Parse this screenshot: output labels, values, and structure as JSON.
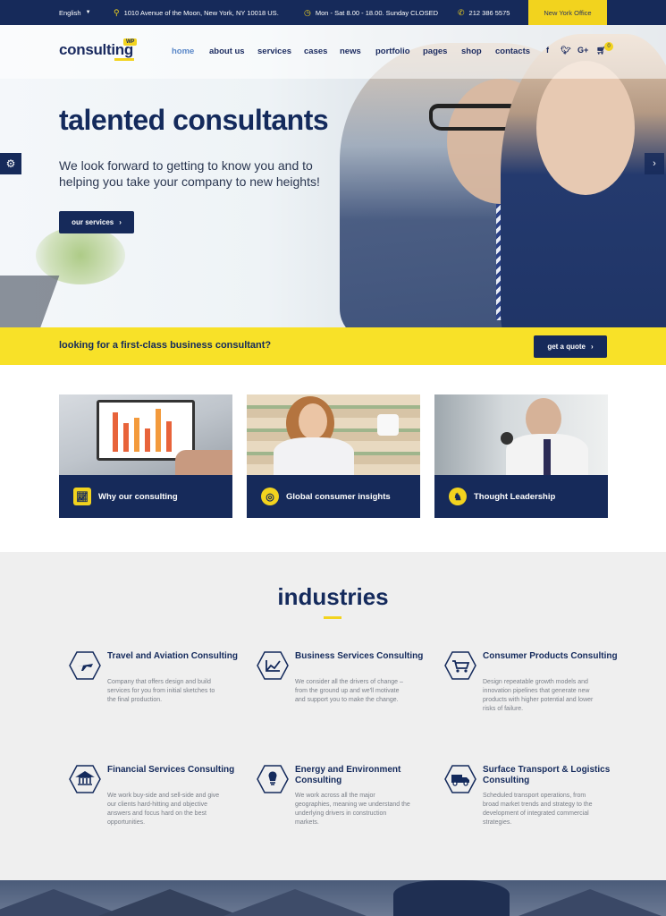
{
  "topbar": {
    "language": "English",
    "address": "1010 Avenue of the Moon, New York, NY 10018 US.",
    "hours": "Mon - Sat 8.00 - 18.00. Sunday CLOSED",
    "phone": "212 386 5575",
    "office": "New York Office"
  },
  "logo": {
    "text": "consulting",
    "badge": "WP"
  },
  "nav": [
    "home",
    "about us",
    "services",
    "cases",
    "news",
    "portfolio",
    "pages",
    "shop",
    "contacts"
  ],
  "social": [
    "f",
    "t",
    "G+"
  ],
  "cart_count": "0",
  "hero": {
    "title": "talented consultants",
    "subtitle": "We look forward to getting to know you and to helping you take your company to new heights!",
    "button": "our services"
  },
  "cta": {
    "text": "looking for a first-class business consultant?",
    "button": "get a quote"
  },
  "cards": [
    {
      "label": "Why our consulting"
    },
    {
      "label": "Global consumer insights"
    },
    {
      "label": "Thought Leadership"
    }
  ],
  "industries": {
    "title": "industries",
    "items": [
      {
        "title": "Travel and Aviation Consulting",
        "desc": "Company that offers design and build services for you from initial sketches to the final production."
      },
      {
        "title": "Business Services Consulting",
        "desc": "We consider all the drivers of change – from the ground up and we'll motivate and support you to make the change."
      },
      {
        "title": "Consumer Products Consulting",
        "desc": "Design repeatable growth models and innovation pipelines that generate new products with higher potential and lower risks of failure."
      },
      {
        "title": "Financial Services Consulting",
        "desc": "We work buy-side and sell-side and give our clients hard-hitting and objective answers and focus hard on the best opportunities."
      },
      {
        "title": "Energy and Environment Consulting",
        "desc": "We work across all the major geographies, meaning we understand the underlying drivers in construction markets."
      },
      {
        "title": "Surface Transport & Logistics Consulting",
        "desc": "Scheduled transport operations, from broad market trends and strategy to the development of integrated commercial strategies."
      }
    ]
  },
  "colors": {
    "navy": "#162a5a",
    "yellow": "#f2d31e",
    "accent_link": "#5a87c8"
  }
}
